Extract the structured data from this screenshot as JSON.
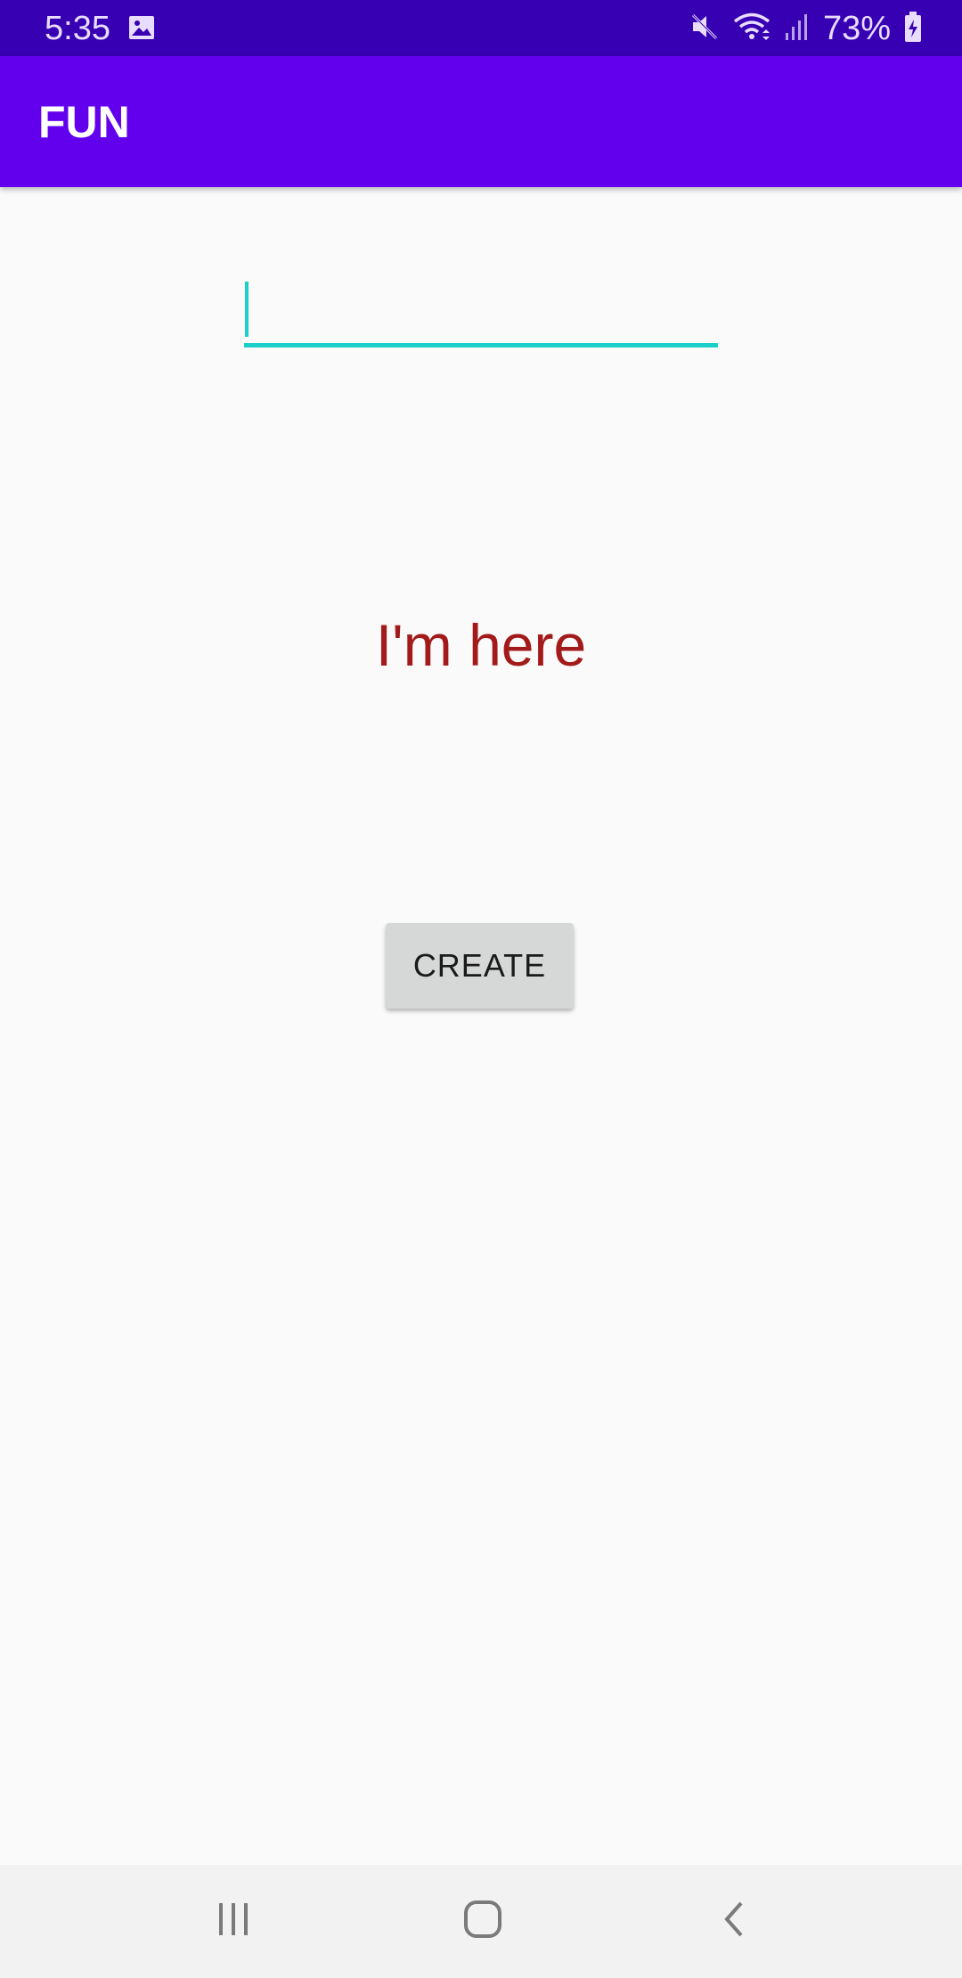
{
  "status_bar": {
    "time": "5:35",
    "battery_percent": "73%",
    "icons": [
      "image-icon",
      "mute-icon",
      "wifi-icon",
      "signal-icon",
      "battery-charging-icon"
    ]
  },
  "app_bar": {
    "title": "FUN",
    "color": "#6200ee"
  },
  "text_field": {
    "value": "",
    "placeholder": "",
    "accent_color": "#1ccfc9"
  },
  "message": {
    "text": "I'm here",
    "color": "#a31a1a"
  },
  "create_button": {
    "label": "CREATE"
  },
  "nav_bar": {
    "icons": [
      "recents-icon",
      "home-icon",
      "back-icon"
    ]
  }
}
